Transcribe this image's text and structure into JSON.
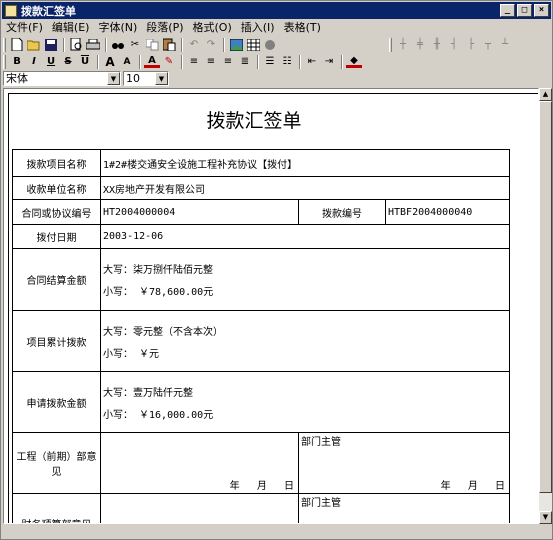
{
  "window": {
    "title": "拨款汇签单"
  },
  "menu": [
    "文件(F)",
    "编辑(E)",
    "字体(N)",
    "段落(P)",
    "格式(O)",
    "插入(I)",
    "表格(T)"
  ],
  "font": {
    "name": "宋体",
    "size": "10"
  },
  "document": {
    "title": "拨款汇签单",
    "rows": [
      {
        "label": "拨款项目名称",
        "value": "1#2#楼交通安全设施工程补充协议【拨付】"
      },
      {
        "label": "收款单位名称",
        "value": "XX房地产开发有限公司"
      },
      {
        "label": "合同或协议编号",
        "value": "HT2004000004",
        "label2": "拨款编号",
        "value2": "HTBF2004000040"
      },
      {
        "label": "拨付日期",
        "value": "2003-12-06"
      },
      {
        "label": "合同结算金额",
        "upper": "大写：柒万捌仟陆佰元整",
        "lower": "小写：  ￥78,600.00元"
      },
      {
        "label": "项目累计拨款",
        "upper": "大写：零元整（不含本次）",
        "lower": "小写：  ￥元"
      },
      {
        "label": "申请拨款金额",
        "upper": "大写：壹万陆仟元整",
        "lower": "小写：  ￥16,000.00元"
      },
      {
        "label": "工程（前期）部意见",
        "head": "部门主管",
        "date": "年 月 日"
      },
      {
        "label": "财务预算部意见",
        "head": "部门主管"
      }
    ]
  }
}
